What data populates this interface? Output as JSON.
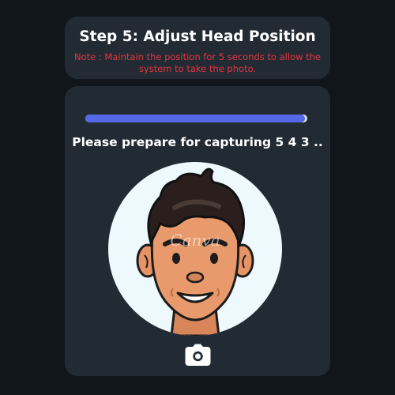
{
  "header": {
    "title": "Step 5: Adjust Head Position",
    "note": "Note : Maintain the position for 5 seconds to allow the system to take the photo."
  },
  "capture": {
    "progress": 0.99,
    "status_text": "Please prepare for capturing 5 4 3 ..",
    "avatar_watermark": "Canva"
  },
  "icons": {
    "camera": "camera-icon"
  },
  "colors": {
    "background": "#11161d",
    "card": "#222a33",
    "note": "#e8343f",
    "progress": "#5468e8",
    "avatar_bg": "#eef9fd"
  }
}
